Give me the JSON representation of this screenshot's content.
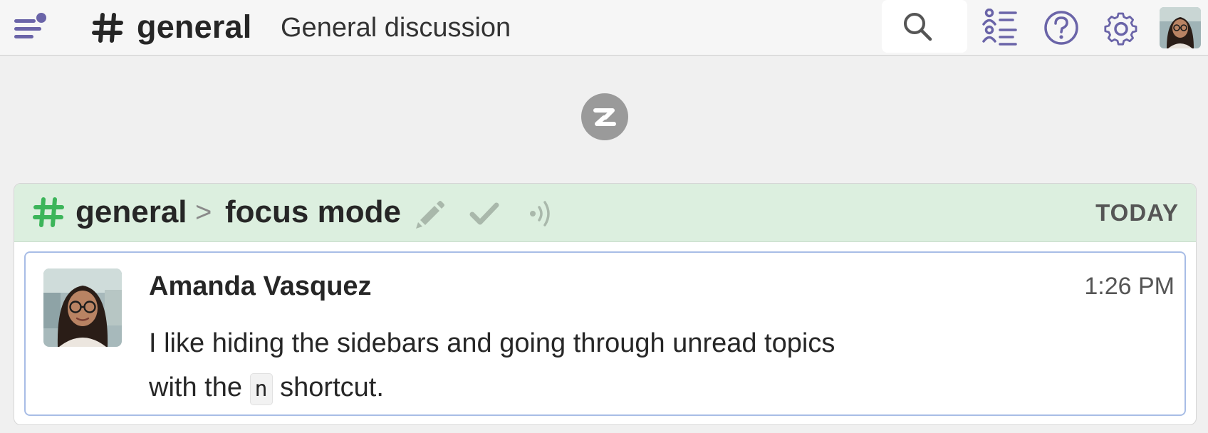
{
  "header": {
    "channel_name": "general",
    "channel_description": "General discussion"
  },
  "icons": {
    "menu": "hamburger-menu-with-dot-icon",
    "search": "search-icon",
    "users": "user-list-icon",
    "help": "help-circle-icon",
    "settings": "gear-icon",
    "logo": "zulip-logo"
  },
  "colors": {
    "accent": "#6a64a8",
    "stream_hash": "#3cb55a",
    "recipient_header_bg": "#dcefdf",
    "selected_message_border": "#a8bde6"
  },
  "recipient": {
    "stream": "general",
    "separator": ">",
    "topic": "focus mode",
    "date": "TODAY"
  },
  "message": {
    "sender": "Amanda Vasquez",
    "time": "1:26 PM",
    "text_line1": "I like hiding the sidebars and going through unread topics",
    "text_line2_before": "with the",
    "shortcut_key": "n",
    "text_line2_after": "shortcut."
  }
}
